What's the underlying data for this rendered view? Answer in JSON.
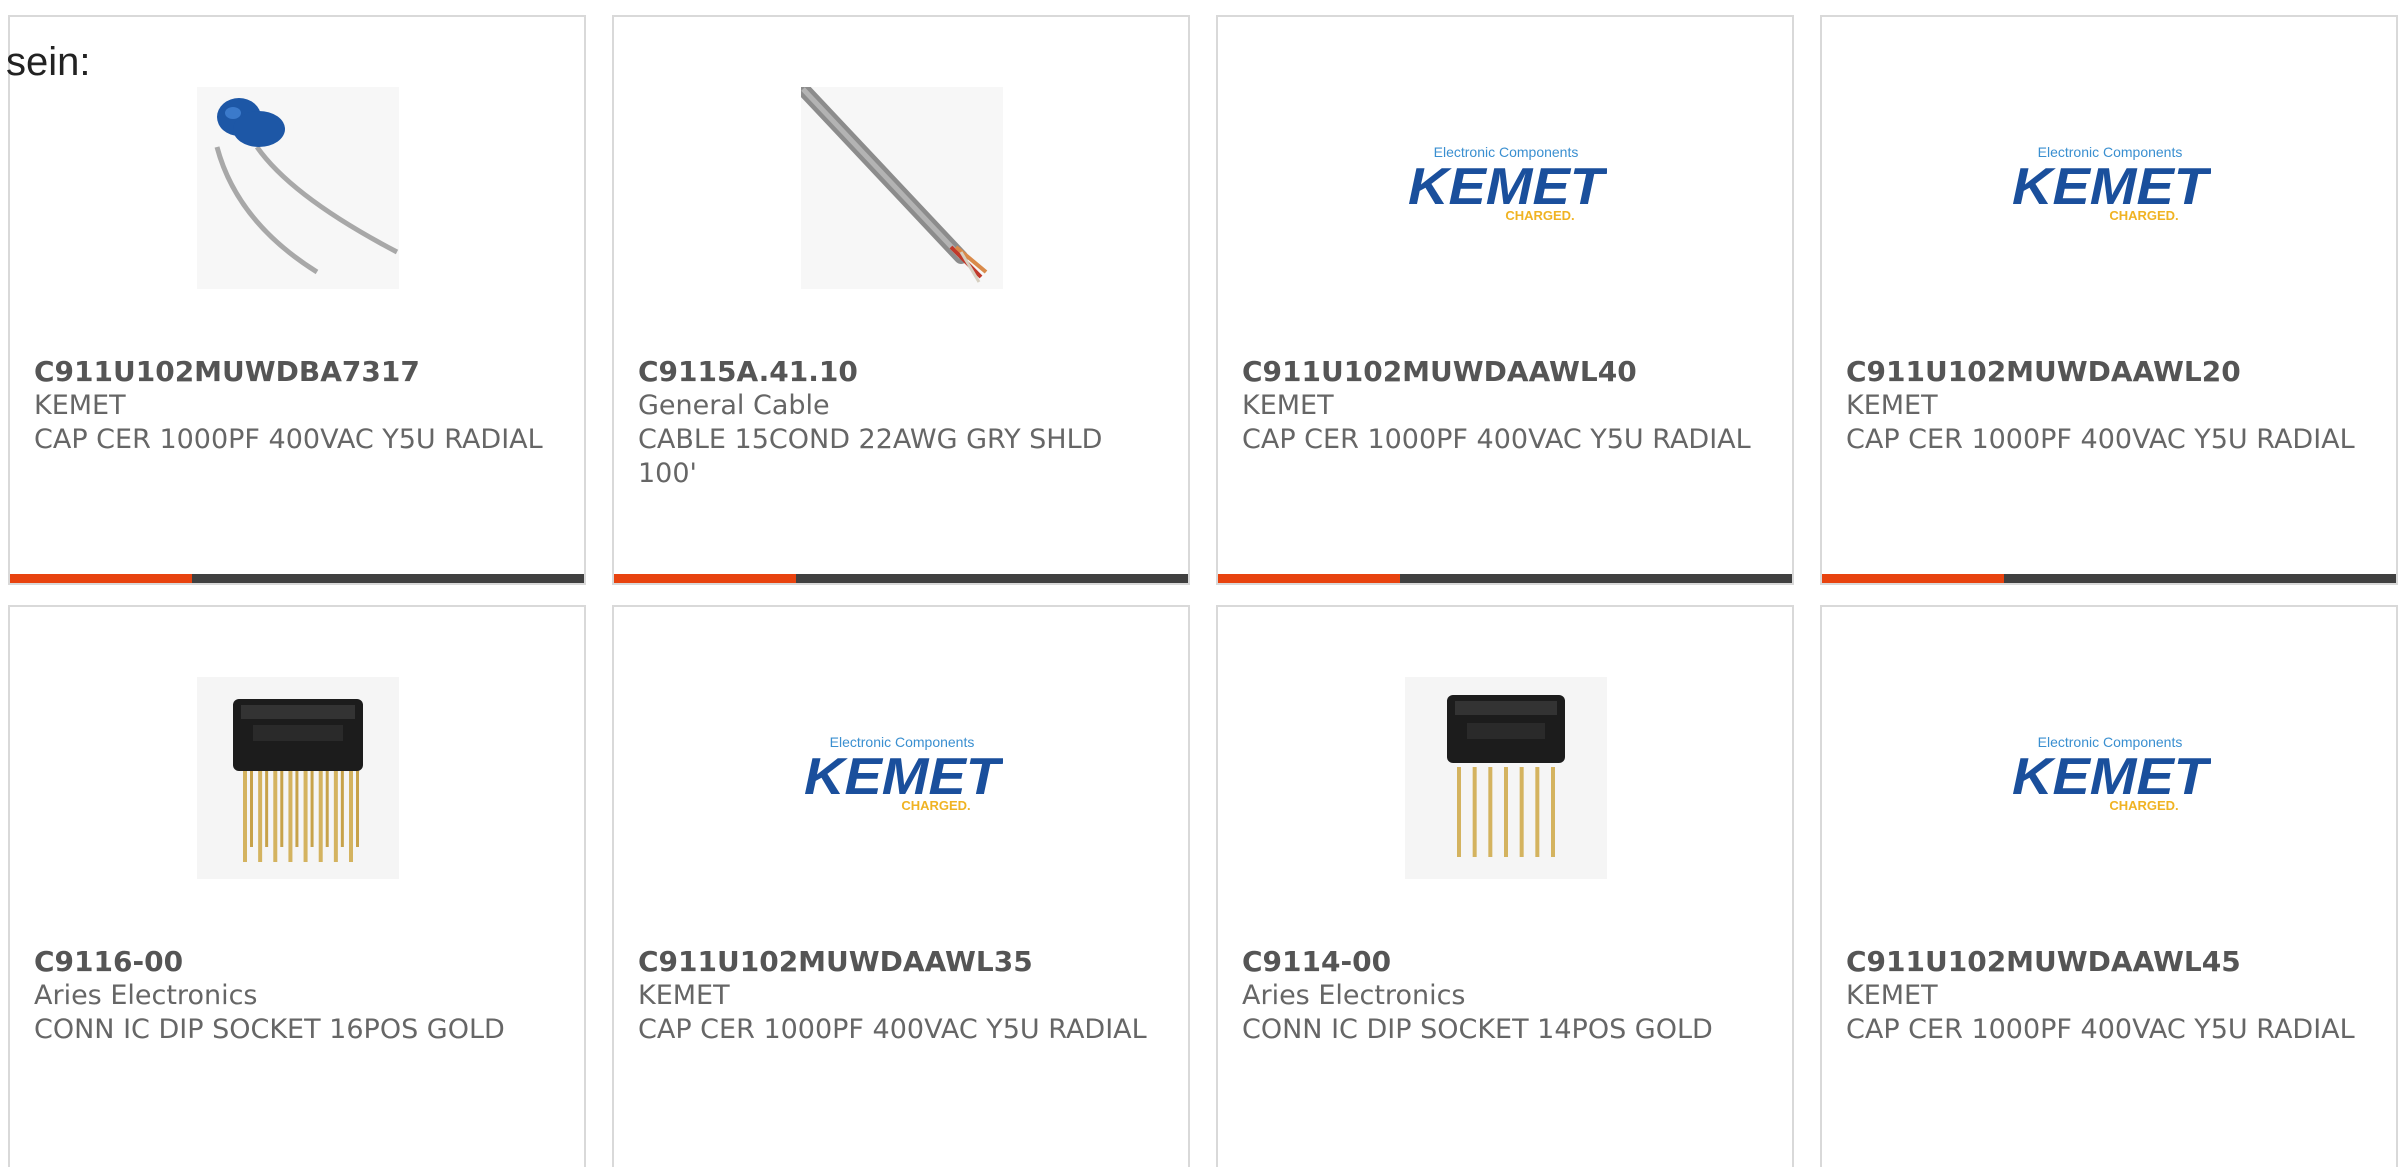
{
  "intro": {
    "text": "sein:"
  },
  "products": [
    {
      "part_number": "C911U102MUWDBA7317",
      "manufacturer": "KEMET",
      "description": "CAP CER 1000PF 400VAC Y5U RADIAL",
      "image": "ceramic-capacitor-icon"
    },
    {
      "part_number": "C9115A.41.10",
      "manufacturer": "General Cable",
      "description": "CABLE 15COND 22AWG GRY SHLD 100'",
      "image": "cable-icon"
    },
    {
      "part_number": "C911U102MUWDAAWL40",
      "manufacturer": "KEMET",
      "description": "CAP CER 1000PF 400VAC Y5U RADIAL",
      "image": "kemet-logo"
    },
    {
      "part_number": "C911U102MUWDAAWL20",
      "manufacturer": "KEMET",
      "description": "CAP CER 1000PF 400VAC Y5U RADIAL",
      "image": "kemet-logo"
    },
    {
      "part_number": "C9116-00",
      "manufacturer": "Aries Electronics",
      "description": "CONN IC DIP SOCKET 16POS GOLD",
      "image": "dip-socket-16-icon"
    },
    {
      "part_number": "C911U102MUWDAAWL35",
      "manufacturer": "KEMET",
      "description": "CAP CER 1000PF 400VAC Y5U RADIAL",
      "image": "kemet-logo"
    },
    {
      "part_number": "C9114-00",
      "manufacturer": "Aries Electronics",
      "description": "CONN IC DIP SOCKET 14POS GOLD",
      "image": "dip-socket-14-icon"
    },
    {
      "part_number": "C911U102MUWDAAWL45",
      "manufacturer": "KEMET",
      "description": "CAP CER 1000PF 400VAC Y5U RADIAL",
      "image": "kemet-logo"
    }
  ],
  "kemet_logo": {
    "tagline": "Electronic Components",
    "name": "KEMET",
    "slogan": "CHARGED."
  },
  "colors": {
    "accent": "#e8430f",
    "bar": "#404040",
    "kemet_blue": "#1a4f9c",
    "kemet_light_blue": "#3a8fd0",
    "kemet_gold": "#f0b323"
  }
}
